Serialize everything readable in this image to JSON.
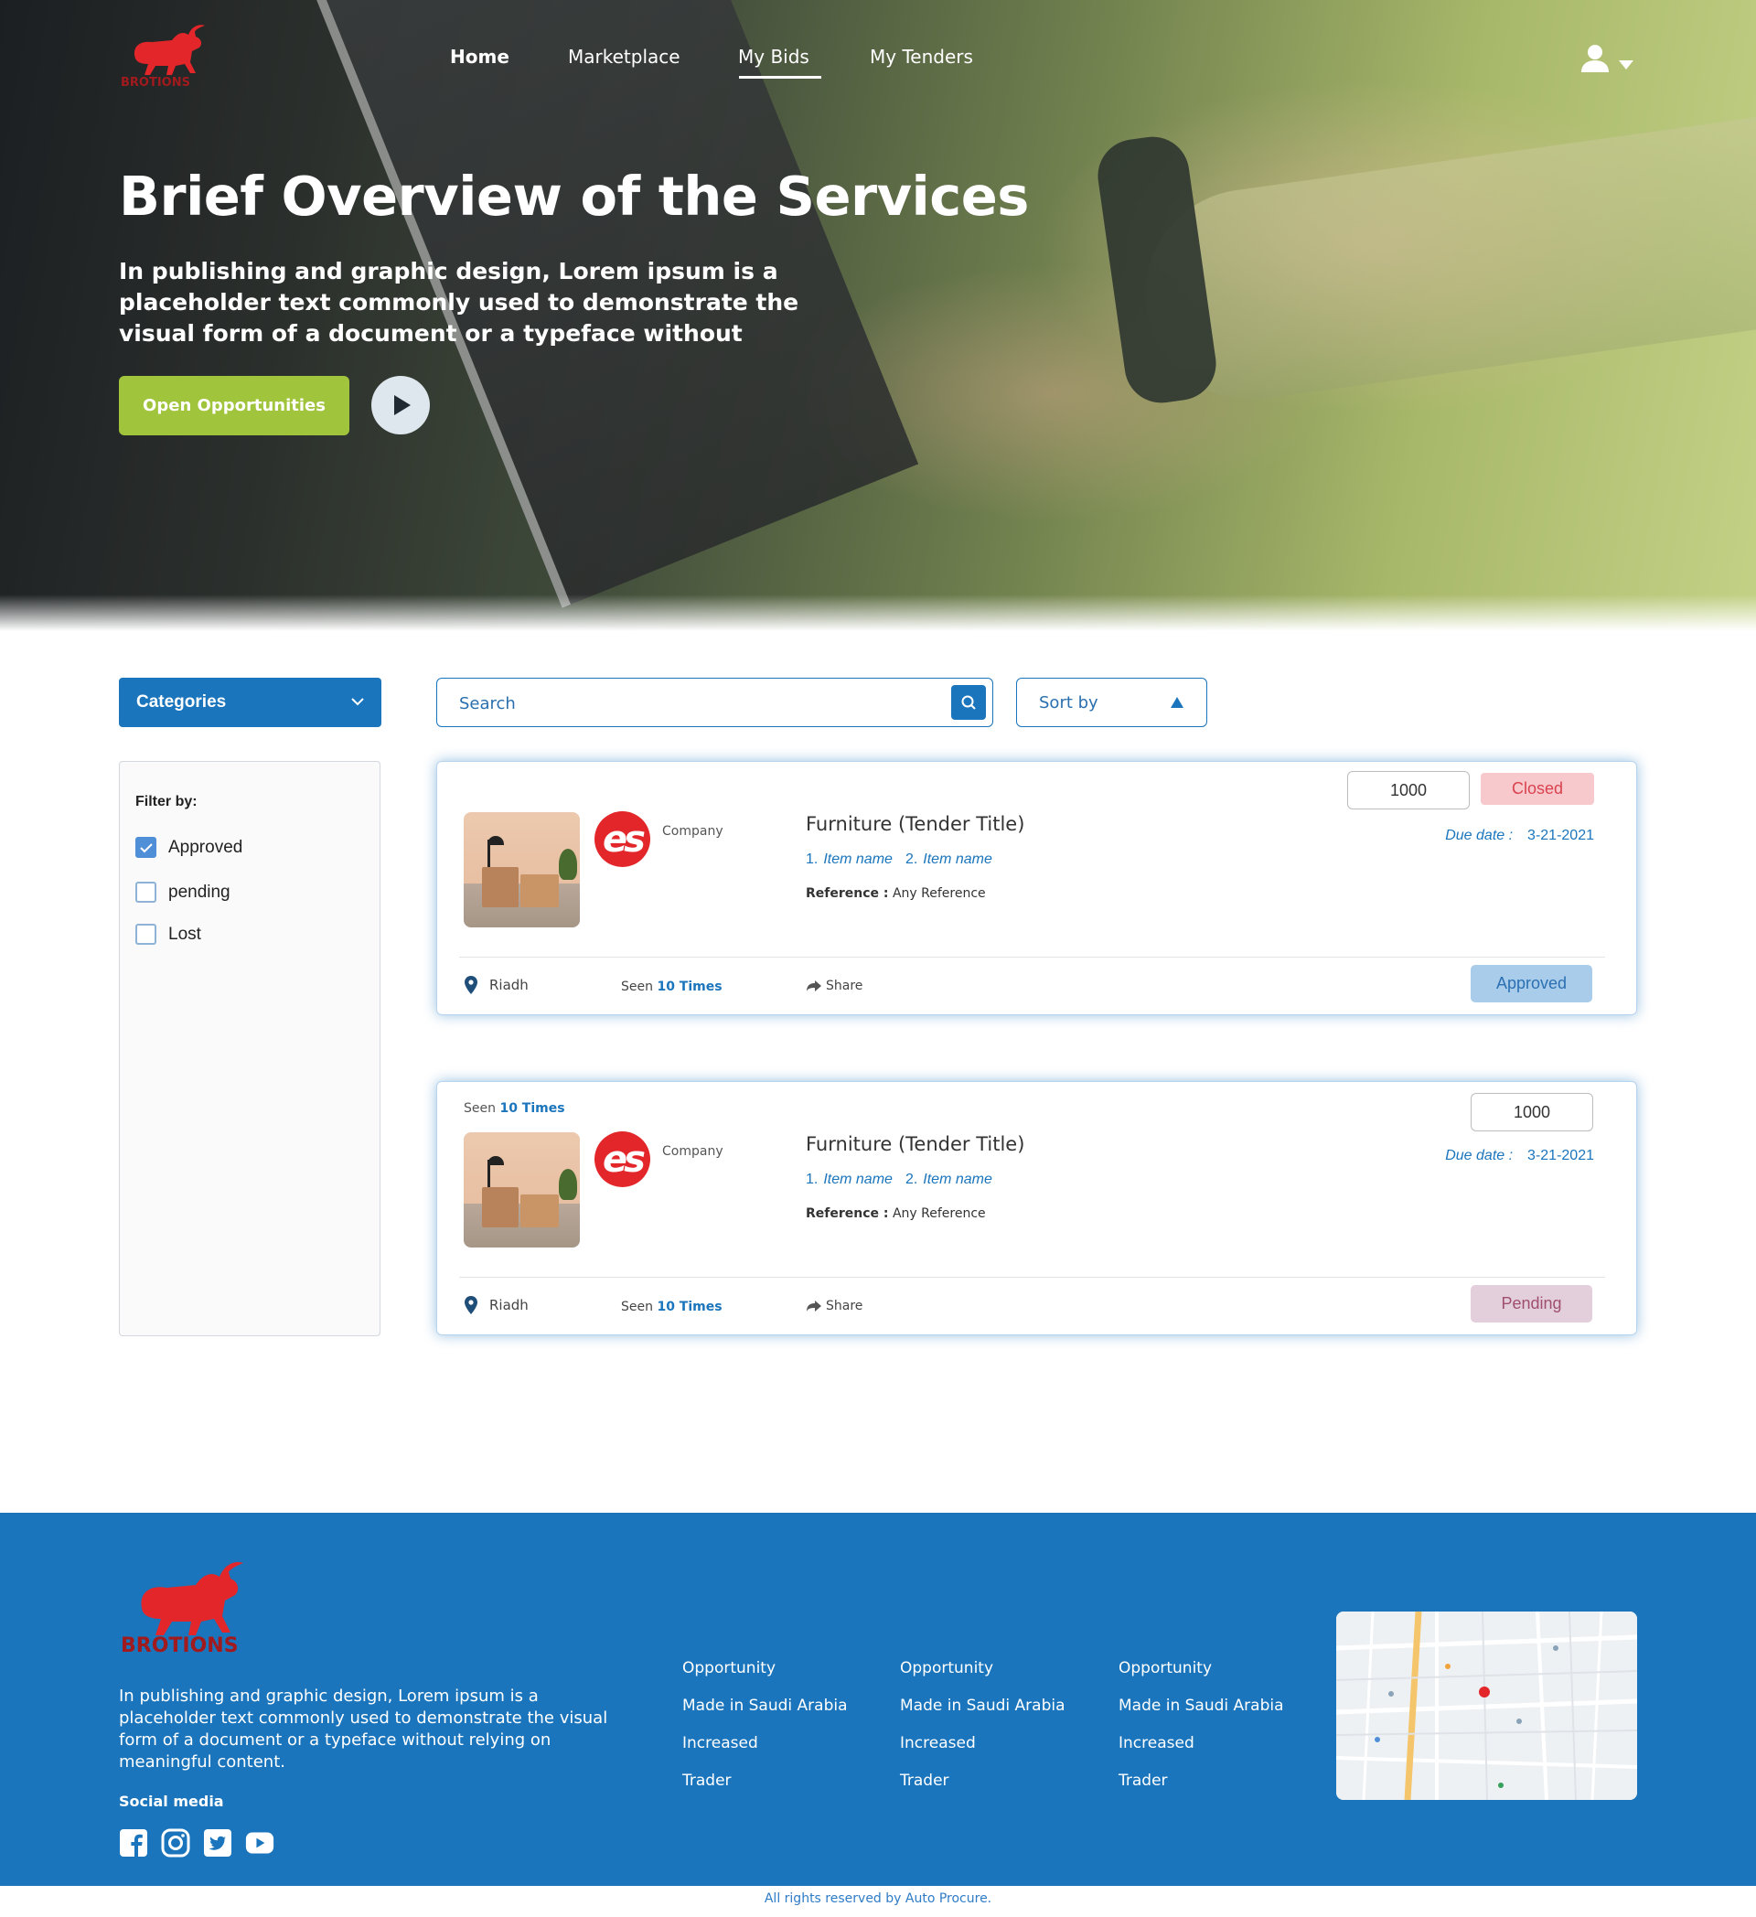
{
  "nav": {
    "logo_text": "BROTIONS",
    "items": [
      {
        "label": "Home"
      },
      {
        "label": "Marketplace"
      },
      {
        "label": "My Bids"
      },
      {
        "label": "My Tenders"
      }
    ],
    "active": "My Bids"
  },
  "hero": {
    "title": "Brief Overview of the Services",
    "subtitle": "In publishing and graphic design, Lorem ipsum is a placeholder text commonly used to demonstrate the visual form of a document or a typeface without",
    "cta_label": "Open Opportunities",
    "play_icon": "play-icon"
  },
  "filters": {
    "categories_label": "Categories",
    "filter_title": "Filter by:",
    "options": [
      {
        "label": "Approved",
        "checked": true
      },
      {
        "label": "pending",
        "checked": false
      },
      {
        "label": "Lost",
        "checked": false
      }
    ]
  },
  "search": {
    "placeholder": "Search"
  },
  "sort": {
    "label": "Sort by"
  },
  "bids": [
    {
      "company": "Company",
      "brand_mark": "es",
      "title": "Furniture (Tender Title)",
      "items": [
        {
          "num": "1.",
          "name": "Item name"
        },
        {
          "num": "2.",
          "name": "Item name"
        }
      ],
      "reference_label": "Reference :",
      "reference": "Any Reference",
      "amount": "1000",
      "top_status": "Closed",
      "due_label": "Due date :",
      "due_date": "3-21-2021",
      "location": "Riadh",
      "seen_prefix": "Seen",
      "seen_value": "10 Times",
      "share_label": "Share",
      "status": "Approved"
    },
    {
      "company": "Company",
      "brand_mark": "es",
      "title": "Furniture (Tender Title)",
      "items": [
        {
          "num": "1.",
          "name": "Item name"
        },
        {
          "num": "2.",
          "name": "Item name"
        }
      ],
      "reference_label": "Reference :",
      "reference": "Any Reference",
      "amount": "1000",
      "due_label": "Due date :",
      "due_date": "3-21-2021",
      "seen_top_prefix": "Seen",
      "seen_top_value": "10 Times",
      "location": "Riadh",
      "seen_prefix": "Seen",
      "seen_value": "10 Times",
      "share_label": "Share",
      "status": "Pending"
    }
  ],
  "footer": {
    "logo_text": "BROTIONS",
    "description": "In publishing and graphic design, Lorem ipsum is a placeholder text commonly used to demonstrate the visual form of a document or a typeface without relying on meaningful content.",
    "social_title": "Social media",
    "social_icons": [
      "facebook-icon",
      "instagram-icon",
      "twitter-icon",
      "youtube-icon"
    ],
    "columns": [
      {
        "links": [
          "Opportunity",
          "Made in Saudi Arabia",
          "Increased",
          "Trader"
        ]
      },
      {
        "links": [
          "Opportunity",
          "Made in Saudi Arabia",
          "Increased",
          "Trader"
        ]
      },
      {
        "links": [
          "Opportunity",
          "Made in Saudi Arabia",
          "Increased",
          "Trader"
        ]
      }
    ],
    "copyright": "All rights reserved by Auto Procure."
  },
  "colors": {
    "primary": "#1b75bc",
    "accent_green": "#a0c43c",
    "brand_red": "#e2262a",
    "closed_bg": "#f7c9cd",
    "approved_bg": "#a9cceb",
    "pending_bg": "#e3cfdb"
  }
}
